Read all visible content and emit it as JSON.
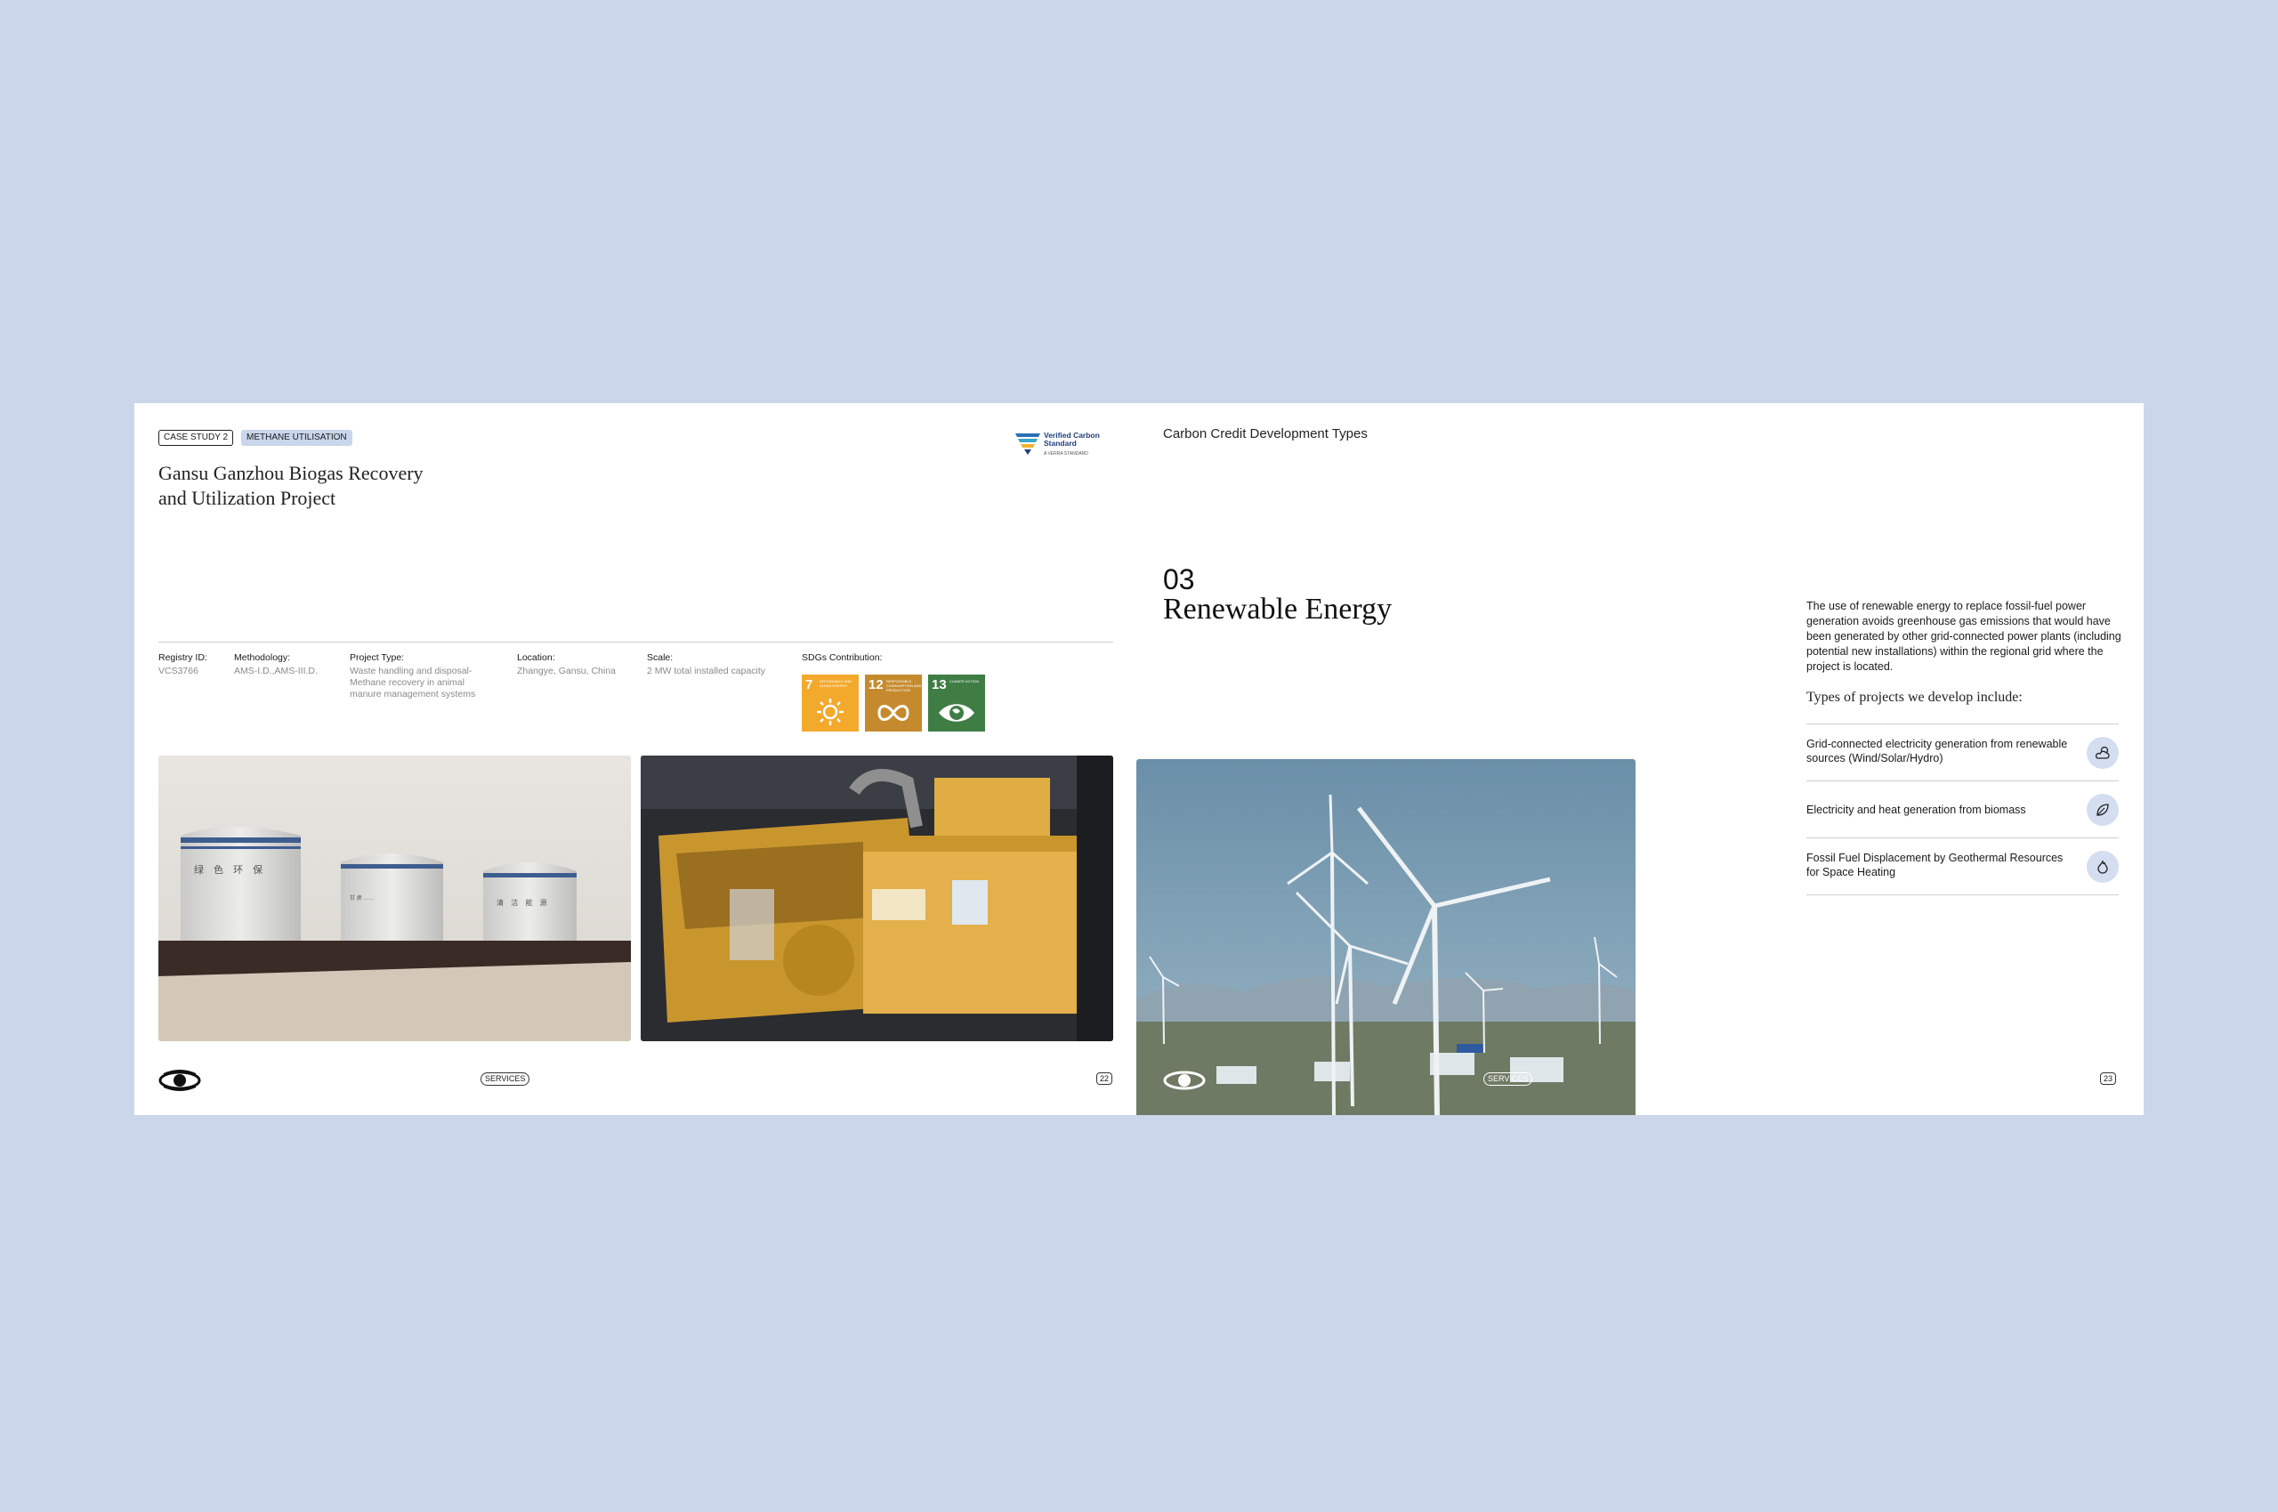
{
  "left_page": {
    "tags": [
      "CASE STUDY 2",
      "METHANE UTILISATION"
    ],
    "title_line1": "Gansu Ganzhou Biogas Recovery",
    "title_line2": "and Utilization Project",
    "vcs_logo": {
      "line1": "Verified Carbon",
      "line2": "Standard",
      "sub": "A VERRA STANDARD"
    },
    "meta": [
      {
        "label": "Registry ID:",
        "lines": [
          "VCS3766"
        ]
      },
      {
        "label": "Methodology:",
        "lines": [
          "AMS-I.D.,AMS-III.D."
        ]
      },
      {
        "label": "Project Type:",
        "lines": [
          "Waste handling and disposal-",
          "Methane recovery in animal",
          "manure management systems"
        ]
      },
      {
        "label": "Location:",
        "lines": [
          "Zhangye, Gansu, China"
        ]
      },
      {
        "label": "Scale:",
        "lines": [
          "2 MW total installed capacity"
        ]
      },
      {
        "label": "SDGs Contribution:",
        "lines": []
      }
    ],
    "sdgs": [
      {
        "number": "7",
        "label": "AFFORDABLE AND CLEAN ENERGY",
        "color": "#f3a92c",
        "icon": "sun-icon"
      },
      {
        "number": "12",
        "label": "RESPONSIBLE CONSUMPTION AND PRODUCTION",
        "color": "#c68a2e",
        "icon": "infinity-icon"
      },
      {
        "number": "13",
        "label": "CLIMATE ACTION",
        "color": "#3f7d44",
        "icon": "eye-globe-icon"
      }
    ],
    "tank_labels": [
      "绿 色 环 保",
      "甘 肃 ……",
      "清 洁 能 源"
    ],
    "footer": {
      "section": "SERVICES",
      "page": "22"
    }
  },
  "right_page": {
    "header": "Carbon Credit Development Types",
    "section_number": "03",
    "section_title": "Renewable Energy",
    "description": "The use of renewable energy to replace fossil-fuel power generation avoids greenhouse gas emissions that would have been generated by other grid-connected power plants (including potential new installations) within the regional grid where the project is located.",
    "types_heading": "Types of projects we develop include:",
    "types": [
      {
        "text": "Grid-connected electricity generation from renewable sources (Wind/Solar/Hydro)",
        "icon": "sun-cloud-icon"
      },
      {
        "text": "Electricity and heat generation from biomass",
        "icon": "leaf-icon"
      },
      {
        "text": "Fossil Fuel Displacement by Geothermal Resources for Space Heating",
        "icon": "flame-icon"
      }
    ],
    "footer": {
      "section": "SERVICES",
      "page": "23"
    }
  },
  "colors": {
    "background": "#cbd6ea",
    "page": "#ffffff",
    "tag_fill": "#c9d6ec",
    "icon_circle": "#d4def0"
  }
}
